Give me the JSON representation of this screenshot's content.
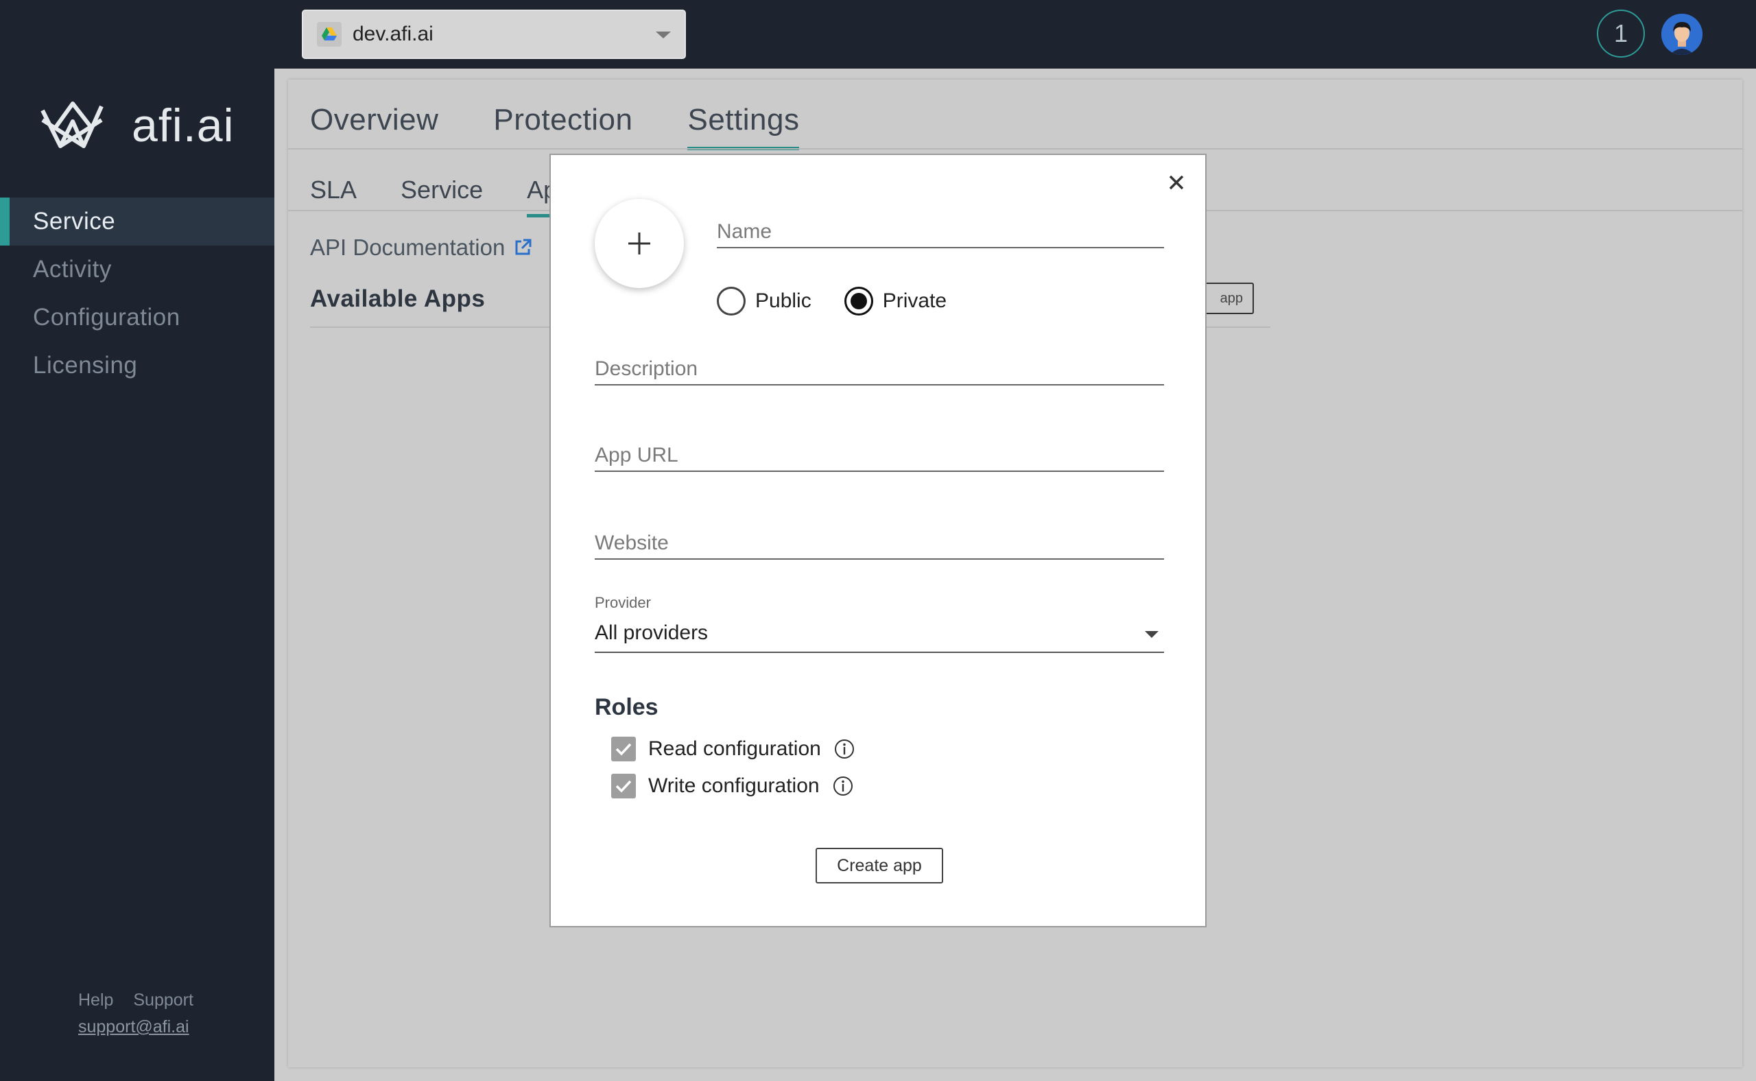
{
  "sidebar": {
    "logo_text": "afi.ai",
    "items": [
      {
        "label": "Service",
        "active": true
      },
      {
        "label": "Activity",
        "active": false
      },
      {
        "label": "Configuration",
        "active": false
      },
      {
        "label": "Licensing",
        "active": false
      }
    ],
    "footer": {
      "help": "Help",
      "support": "Support",
      "email": "support@afi.ai"
    }
  },
  "topbar": {
    "tenant": "dev.afi.ai",
    "tenant_icon": "google-drive-icon",
    "notifications_count": "1",
    "avatar_icon": "user-avatar"
  },
  "main": {
    "tabs": [
      {
        "label": "Overview",
        "active": false
      },
      {
        "label": "Protection",
        "active": false
      },
      {
        "label": "Settings",
        "active": true
      }
    ],
    "subtabs": [
      {
        "label": "SLA",
        "active": false
      },
      {
        "label": "Service",
        "active": false
      },
      {
        "label": "Ap",
        "active": true
      }
    ],
    "api_doc_label": "API Documentation",
    "available_apps_title": "Available Apps",
    "create_app_partial": "app"
  },
  "modal": {
    "name_placeholder": "Name",
    "visibility": {
      "public_label": "Public",
      "private_label": "Private",
      "selected": "Private"
    },
    "description_placeholder": "Description",
    "app_url_placeholder": "App URL",
    "website_placeholder": "Website",
    "provider": {
      "label": "Provider",
      "value": "All providers"
    },
    "roles_title": "Roles",
    "roles": [
      {
        "label": "Read configuration",
        "checked": true
      },
      {
        "label": "Write configuration",
        "checked": true
      }
    ],
    "create_button": "Create app"
  },
  "colors": {
    "accent": "#2e9c96",
    "sidebar_bg": "#1d2430",
    "overlay_bg": "#cccccc"
  }
}
